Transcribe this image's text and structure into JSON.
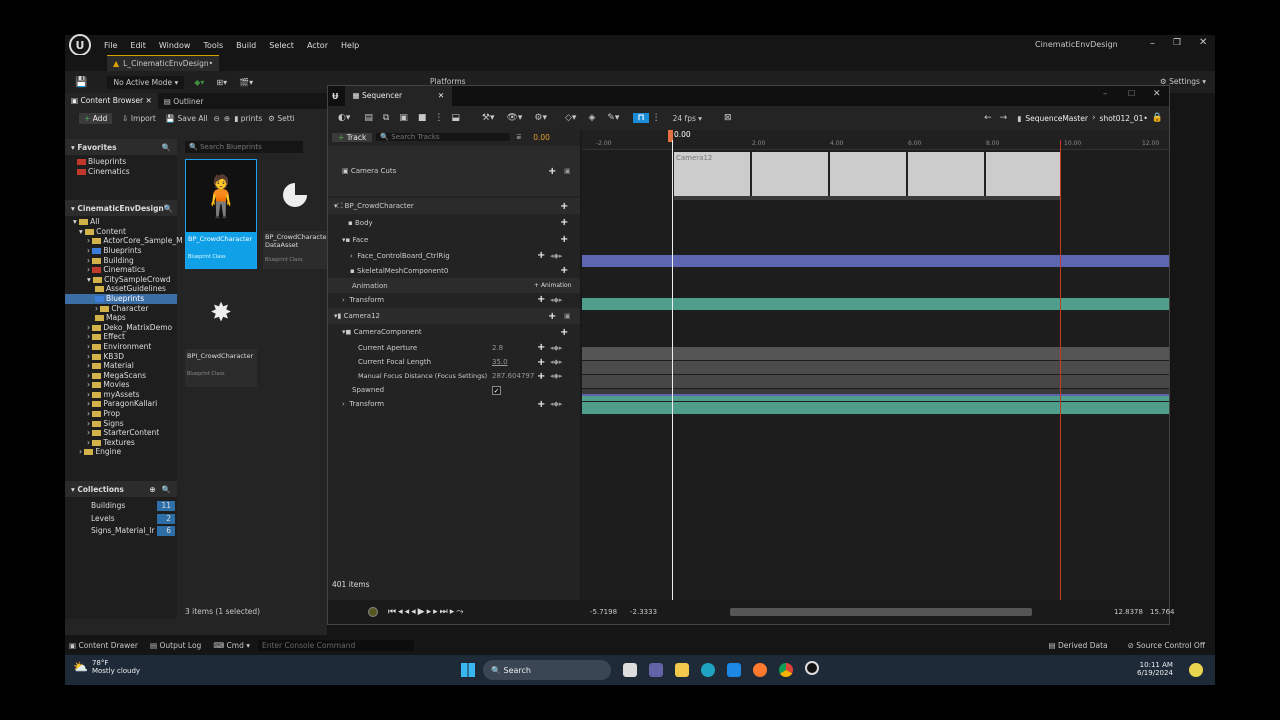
{
  "menu": {
    "items": [
      "File",
      "Edit",
      "Window",
      "Tools",
      "Build",
      "Select",
      "Actor",
      "Help"
    ],
    "project": "CinematicEnvDesign"
  },
  "level_tab": "L_CinematicEnvDesign•",
  "toolbar": {
    "mode": "No Active Mode",
    "platforms": "Platforms",
    "settings": "Settings"
  },
  "content_browser": {
    "tab": "Content Browser",
    "outliner_tab": "Outliner",
    "add": "Add",
    "import": "Import",
    "save_all": "Save All",
    "path": "prints",
    "settings": "Setti",
    "favorites": "Favorites",
    "favorite_items": [
      "Blueprints",
      "Cinematics"
    ],
    "search_placeholder": "Search Blueprints",
    "root": "CinematicEnvDesign",
    "tree": [
      "All",
      "Content",
      "ActorCore_Sample_M",
      "Blueprints",
      "Building",
      "Cinematics",
      "CitySampleCrowd",
      "AssetGuidelines",
      "Blueprints",
      "Character",
      "Maps",
      "Deko_MatrixDemo",
      "Effect",
      "Environment",
      "KB3D",
      "Material",
      "MegaScans",
      "Movies",
      "myAssets",
      "ParagonKallari",
      "Prop",
      "Signs",
      "StarterContent",
      "Textures",
      "Engine"
    ],
    "assets": [
      {
        "name": "BP_CrowdCharacter",
        "type": "Blueprint Class"
      },
      {
        "name": "BP_CrowdCharacter DataAsset",
        "type": "Blueprint Class"
      },
      {
        "name": "BPI_CrowdCharacter",
        "type": "Blueprint Class"
      }
    ],
    "collections": "Collections",
    "collection_items": [
      {
        "name": "Buildings",
        "count": "11"
      },
      {
        "name": "Levels",
        "count": "2"
      },
      {
        "name": "Signs_Material_Ir",
        "count": "6"
      }
    ],
    "selection": "3 items (1 selected)"
  },
  "sequencer": {
    "title": "Sequencer",
    "track_btn": "Track",
    "search_tracks": "Search Tracks",
    "time": "0.00",
    "fps": "24 fps",
    "breadcrumb1": "SequenceMaster",
    "breadcrumb2": "shot012_01•",
    "ticks": [
      "-2.00",
      "0.00",
      "2.00",
      "4.00",
      "6.00",
      "8.00",
      "10.00",
      "12.00"
    ],
    "playhead": "0.00",
    "camera_clip": "Camera12",
    "tracks": [
      {
        "label": "Camera Cuts"
      },
      {
        "label": "BP_CrowdCharacter"
      },
      {
        "label": "Body"
      },
      {
        "label": "Face"
      },
      {
        "label": "Face_ControlBoard_CtrlRig"
      },
      {
        "label": "SkeletalMeshComponent0"
      },
      {
        "label": "Animation",
        "btn": "Animation"
      },
      {
        "label": "Transform"
      },
      {
        "label": "Camera12"
      },
      {
        "label": "CameraComponent"
      },
      {
        "label": "Current Aperture",
        "value": "2.8"
      },
      {
        "label": "Current Focal Length",
        "value": "35.0"
      },
      {
        "label": "Manual Focus Distance (Focus Settings)",
        "value": "287.604797"
      },
      {
        "label": "Spawned"
      },
      {
        "label": "Transform"
      }
    ],
    "items_count": "401 items",
    "range_start": "-5.7198",
    "range_in": "-2.3333",
    "range_out": "12.8378",
    "range_end": "15.764"
  },
  "statusbar": {
    "drawer": "Content Drawer",
    "output": "Output Log",
    "cmd": "Cmd",
    "console": "Enter Console Command",
    "derived": "Derived Data",
    "source": "Source Control Off"
  },
  "taskbar": {
    "temp": "78°F",
    "weather": "Mostly cloudy",
    "search": "Search",
    "time": "10:11 AM",
    "date": "6/19/2024"
  }
}
